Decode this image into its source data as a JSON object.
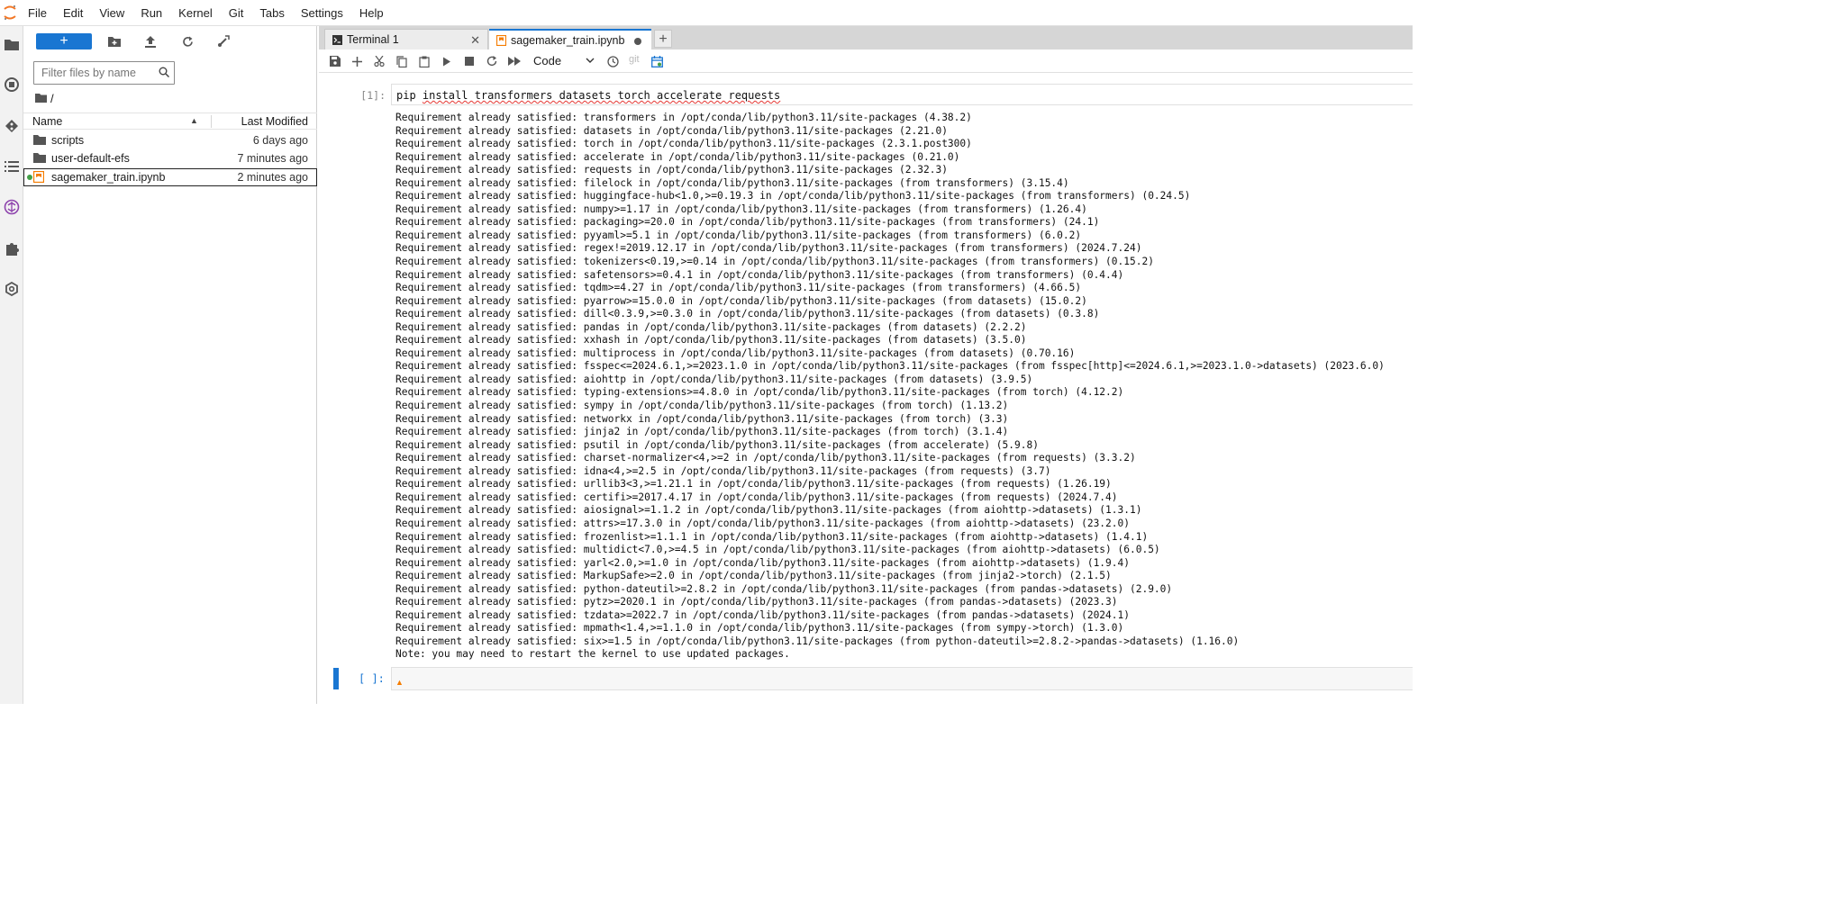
{
  "menubar": {
    "items": [
      "File",
      "Edit",
      "View",
      "Run",
      "Kernel",
      "Git",
      "Tabs",
      "Settings",
      "Help"
    ]
  },
  "filebrowser": {
    "new_label": "+",
    "filter_placeholder": "Filter files by name",
    "breadcrumb": "/",
    "col_name": "Name",
    "col_modified": "Last Modified",
    "files": [
      {
        "name": "scripts",
        "modified": "6 days ago",
        "type": "folder"
      },
      {
        "name": "user-default-efs",
        "modified": "7 minutes ago",
        "type": "folder"
      },
      {
        "name": "sagemaker_train.ipynb",
        "modified": "2 minutes ago",
        "type": "notebook",
        "selected": true,
        "running": true
      }
    ]
  },
  "tabs": [
    {
      "label": "Terminal 1",
      "type": "terminal",
      "active": false
    },
    {
      "label": "sagemaker_train.ipynb",
      "type": "notebook",
      "active": true,
      "dirty": true
    }
  ],
  "notebook_toolbar": {
    "cell_type": "Code",
    "git_label": "git"
  },
  "cells": {
    "cell1_prompt": "[1]:",
    "cell1_code_prefix": "pip ",
    "cell1_code_rest": "install transformers datasets torch accelerate requests",
    "cell2_prompt": "[ ]:"
  },
  "output_lines": [
    "Requirement already satisfied: transformers in /opt/conda/lib/python3.11/site-packages (4.38.2)",
    "Requirement already satisfied: datasets in /opt/conda/lib/python3.11/site-packages (2.21.0)",
    "Requirement already satisfied: torch in /opt/conda/lib/python3.11/site-packages (2.3.1.post300)",
    "Requirement already satisfied: accelerate in /opt/conda/lib/python3.11/site-packages (0.21.0)",
    "Requirement already satisfied: requests in /opt/conda/lib/python3.11/site-packages (2.32.3)",
    "Requirement already satisfied: filelock in /opt/conda/lib/python3.11/site-packages (from transformers) (3.15.4)",
    "Requirement already satisfied: huggingface-hub<1.0,>=0.19.3 in /opt/conda/lib/python3.11/site-packages (from transformers) (0.24.5)",
    "Requirement already satisfied: numpy>=1.17 in /opt/conda/lib/python3.11/site-packages (from transformers) (1.26.4)",
    "Requirement already satisfied: packaging>=20.0 in /opt/conda/lib/python3.11/site-packages (from transformers) (24.1)",
    "Requirement already satisfied: pyyaml>=5.1 in /opt/conda/lib/python3.11/site-packages (from transformers) (6.0.2)",
    "Requirement already satisfied: regex!=2019.12.17 in /opt/conda/lib/python3.11/site-packages (from transformers) (2024.7.24)",
    "Requirement already satisfied: tokenizers<0.19,>=0.14 in /opt/conda/lib/python3.11/site-packages (from transformers) (0.15.2)",
    "Requirement already satisfied: safetensors>=0.4.1 in /opt/conda/lib/python3.11/site-packages (from transformers) (0.4.4)",
    "Requirement already satisfied: tqdm>=4.27 in /opt/conda/lib/python3.11/site-packages (from transformers) (4.66.5)",
    "Requirement already satisfied: pyarrow>=15.0.0 in /opt/conda/lib/python3.11/site-packages (from datasets) (15.0.2)",
    "Requirement already satisfied: dill<0.3.9,>=0.3.0 in /opt/conda/lib/python3.11/site-packages (from datasets) (0.3.8)",
    "Requirement already satisfied: pandas in /opt/conda/lib/python3.11/site-packages (from datasets) (2.2.2)",
    "Requirement already satisfied: xxhash in /opt/conda/lib/python3.11/site-packages (from datasets) (3.5.0)",
    "Requirement already satisfied: multiprocess in /opt/conda/lib/python3.11/site-packages (from datasets) (0.70.16)",
    "Requirement already satisfied: fsspec<=2024.6.1,>=2023.1.0 in /opt/conda/lib/python3.11/site-packages (from fsspec[http]<=2024.6.1,>=2023.1.0->datasets) (2023.6.0)",
    "Requirement already satisfied: aiohttp in /opt/conda/lib/python3.11/site-packages (from datasets) (3.9.5)",
    "Requirement already satisfied: typing-extensions>=4.8.0 in /opt/conda/lib/python3.11/site-packages (from torch) (4.12.2)",
    "Requirement already satisfied: sympy in /opt/conda/lib/python3.11/site-packages (from torch) (1.13.2)",
    "Requirement already satisfied: networkx in /opt/conda/lib/python3.11/site-packages (from torch) (3.3)",
    "Requirement already satisfied: jinja2 in /opt/conda/lib/python3.11/site-packages (from torch) (3.1.4)",
    "Requirement already satisfied: psutil in /opt/conda/lib/python3.11/site-packages (from accelerate) (5.9.8)",
    "Requirement already satisfied: charset-normalizer<4,>=2 in /opt/conda/lib/python3.11/site-packages (from requests) (3.3.2)",
    "Requirement already satisfied: idna<4,>=2.5 in /opt/conda/lib/python3.11/site-packages (from requests) (3.7)",
    "Requirement already satisfied: urllib3<3,>=1.21.1 in /opt/conda/lib/python3.11/site-packages (from requests) (1.26.19)",
    "Requirement already satisfied: certifi>=2017.4.17 in /opt/conda/lib/python3.11/site-packages (from requests) (2024.7.4)",
    "Requirement already satisfied: aiosignal>=1.1.2 in /opt/conda/lib/python3.11/site-packages (from aiohttp->datasets) (1.3.1)",
    "Requirement already satisfied: attrs>=17.3.0 in /opt/conda/lib/python3.11/site-packages (from aiohttp->datasets) (23.2.0)",
    "Requirement already satisfied: frozenlist>=1.1.1 in /opt/conda/lib/python3.11/site-packages (from aiohttp->datasets) (1.4.1)",
    "Requirement already satisfied: multidict<7.0,>=4.5 in /opt/conda/lib/python3.11/site-packages (from aiohttp->datasets) (6.0.5)",
    "Requirement already satisfied: yarl<2.0,>=1.0 in /opt/conda/lib/python3.11/site-packages (from aiohttp->datasets) (1.9.4)",
    "Requirement already satisfied: MarkupSafe>=2.0 in /opt/conda/lib/python3.11/site-packages (from jinja2->torch) (2.1.5)",
    "Requirement already satisfied: python-dateutil>=2.8.2 in /opt/conda/lib/python3.11/site-packages (from pandas->datasets) (2.9.0)",
    "Requirement already satisfied: pytz>=2020.1 in /opt/conda/lib/python3.11/site-packages (from pandas->datasets) (2023.3)",
    "Requirement already satisfied: tzdata>=2022.7 in /opt/conda/lib/python3.11/site-packages (from pandas->datasets) (2024.1)",
    "Requirement already satisfied: mpmath<1.4,>=1.1.0 in /opt/conda/lib/python3.11/site-packages (from sympy->torch) (1.3.0)",
    "Requirement already satisfied: six>=1.5 in /opt/conda/lib/python3.11/site-packages (from python-dateutil>=2.8.2->pandas->datasets) (1.16.0)",
    "Note: you may need to restart the kernel to use updated packages."
  ],
  "colors": {
    "accent": "#1976d2",
    "notebook_icon": "#f57c00",
    "running": "#43a047"
  }
}
